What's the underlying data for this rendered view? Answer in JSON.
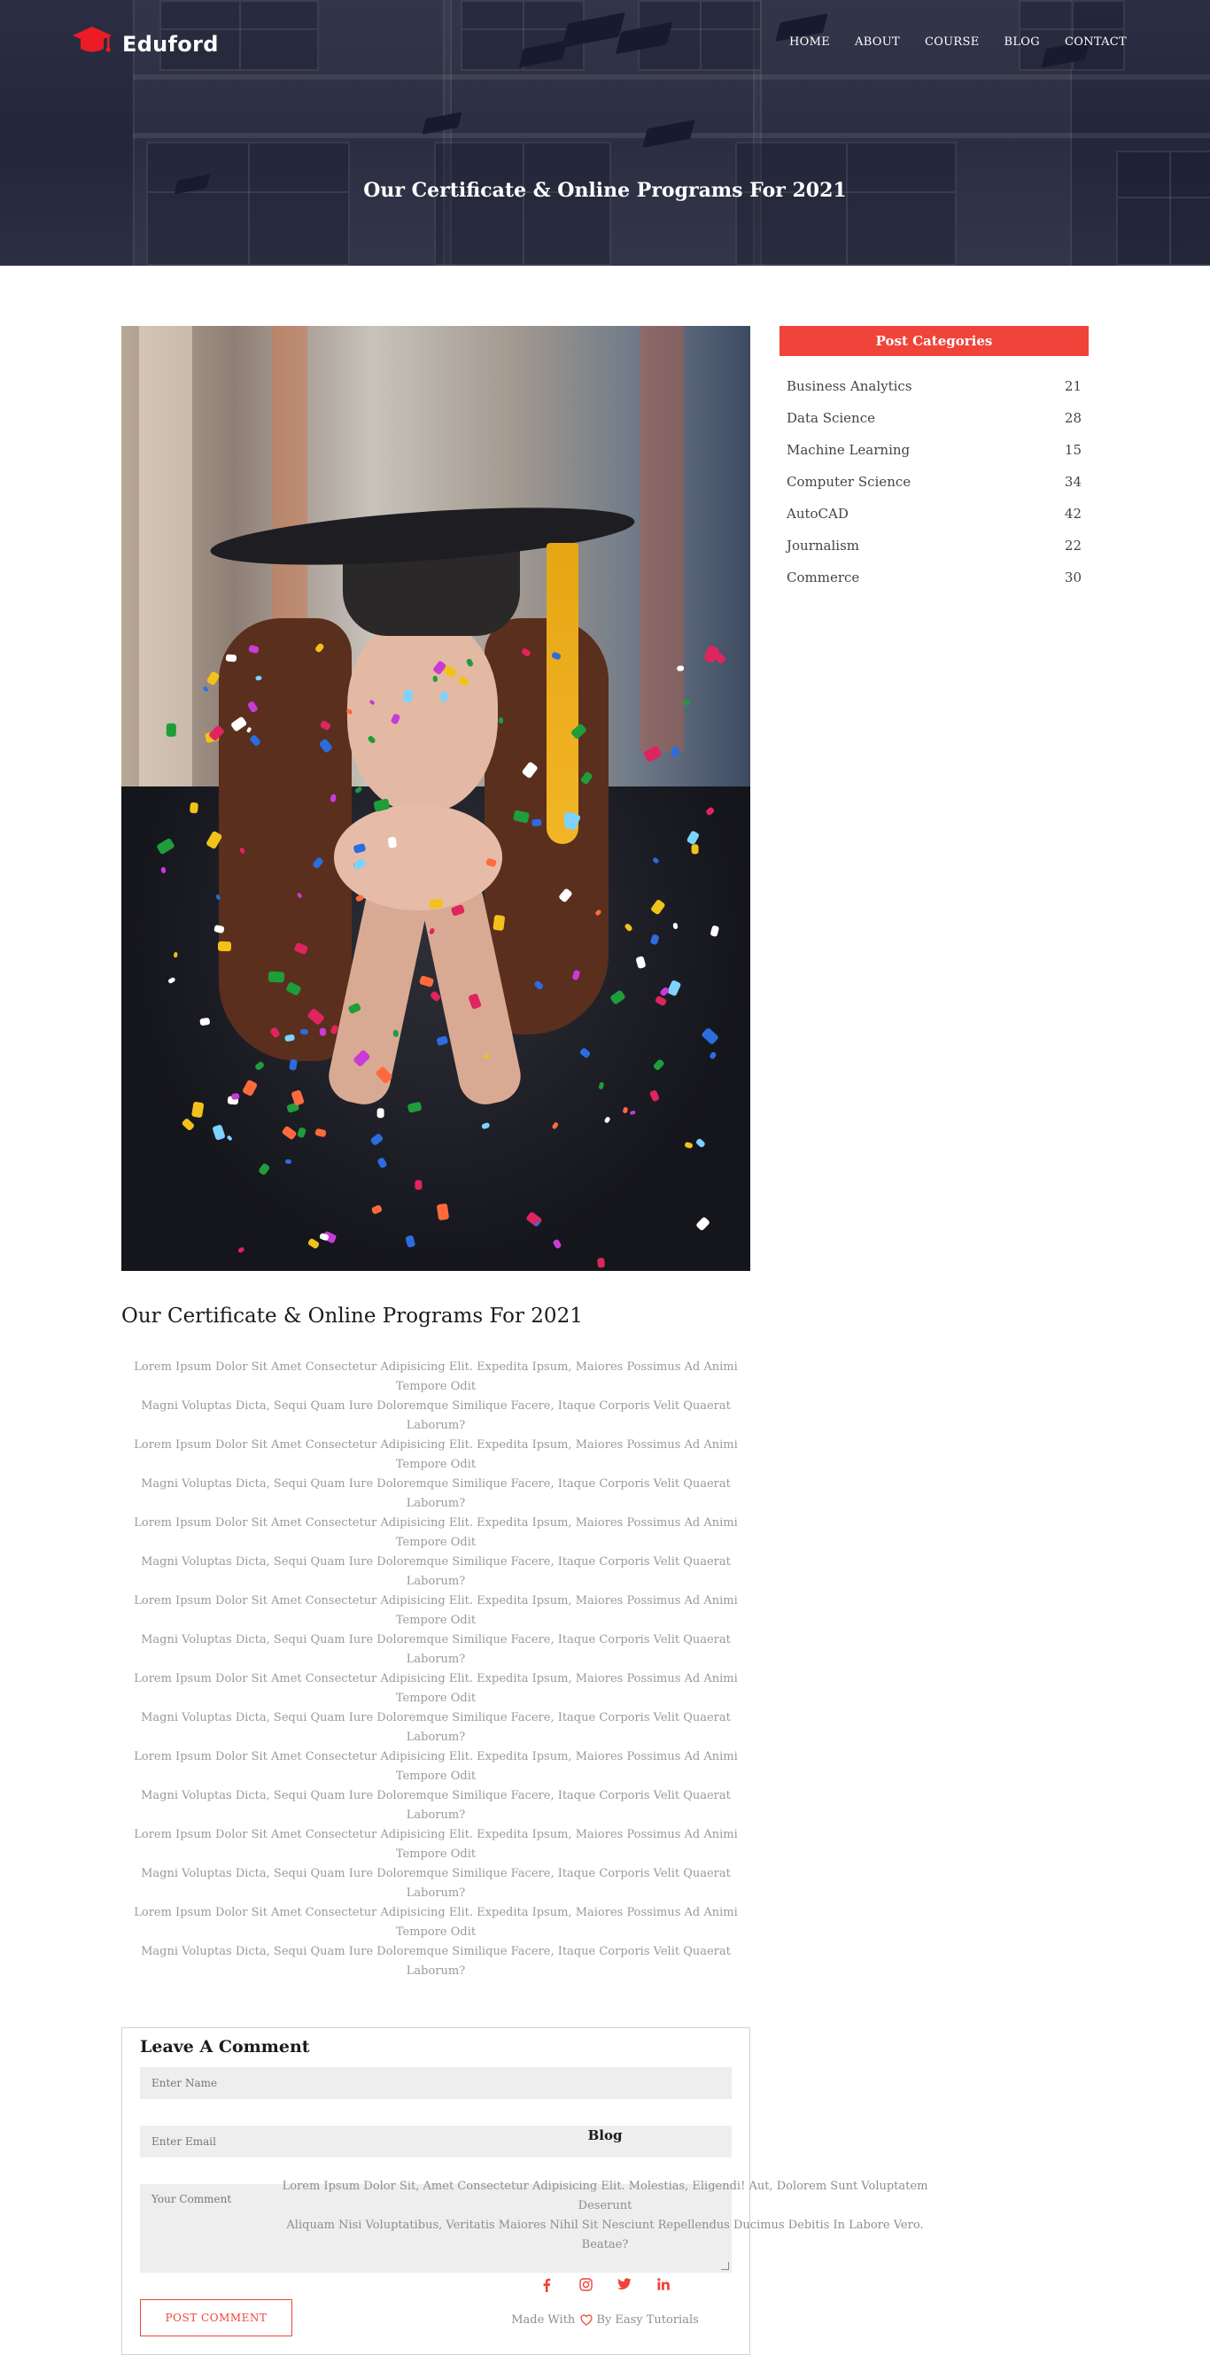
{
  "brand": {
    "name": "Eduford",
    "icon": "graduation-cap-icon",
    "accent_color": "#f04339"
  },
  "nav": {
    "items": [
      "HOME",
      "ABOUT",
      "COURSE",
      "BLOG",
      "CONTACT"
    ]
  },
  "hero": {
    "title": "Our Certificate & Online Programs For 2021"
  },
  "post": {
    "title": "Our Certificate & Online Programs For 2021",
    "paragraph_lines": [
      "Lorem Ipsum Dolor Sit Amet Consectetur Adipisicing Elit. Expedita Ipsum, Maiores Possimus Ad Animi Tempore Odit",
      "Magni Voluptas Dicta, Sequi Quam Iure Doloremque Similique Facere, Itaque Corporis Velit Quaerat Laborum?",
      "Lorem Ipsum Dolor Sit Amet Consectetur Adipisicing Elit. Expedita Ipsum, Maiores Possimus Ad Animi Tempore Odit",
      "Magni Voluptas Dicta, Sequi Quam Iure Doloremque Similique Facere, Itaque Corporis Velit Quaerat Laborum?",
      "Lorem Ipsum Dolor Sit Amet Consectetur Adipisicing Elit. Expedita Ipsum, Maiores Possimus Ad Animi Tempore Odit",
      "Magni Voluptas Dicta, Sequi Quam Iure Doloremque Similique Facere, Itaque Corporis Velit Quaerat Laborum?",
      "Lorem Ipsum Dolor Sit Amet Consectetur Adipisicing Elit. Expedita Ipsum, Maiores Possimus Ad Animi Tempore Odit",
      "Magni Voluptas Dicta, Sequi Quam Iure Doloremque Similique Facere, Itaque Corporis Velit Quaerat Laborum?",
      "Lorem Ipsum Dolor Sit Amet Consectetur Adipisicing Elit. Expedita Ipsum, Maiores Possimus Ad Animi Tempore Odit",
      "Magni Voluptas Dicta, Sequi Quam Iure Doloremque Similique Facere, Itaque Corporis Velit Quaerat Laborum?",
      "Lorem Ipsum Dolor Sit Amet Consectetur Adipisicing Elit. Expedita Ipsum, Maiores Possimus Ad Animi Tempore Odit",
      "Magni Voluptas Dicta, Sequi Quam Iure Doloremque Similique Facere, Itaque Corporis Velit Quaerat Laborum?",
      "Lorem Ipsum Dolor Sit Amet Consectetur Adipisicing Elit. Expedita Ipsum, Maiores Possimus Ad Animi Tempore Odit",
      "Magni Voluptas Dicta, Sequi Quam Iure Doloremque Similique Facere, Itaque Corporis Velit Quaerat Laborum?",
      "Lorem Ipsum Dolor Sit Amet Consectetur Adipisicing Elit. Expedita Ipsum, Maiores Possimus Ad Animi Tempore Odit",
      "Magni Voluptas Dicta, Sequi Quam Iure Doloremque Similique Facere, Itaque Corporis Velit Quaerat Laborum?"
    ]
  },
  "comment_form": {
    "title": "Leave A Comment",
    "name_placeholder": "Enter Name",
    "email_placeholder": "Enter Email",
    "comment_placeholder": "Your Comment",
    "submit_label": "POST COMMENT"
  },
  "sidebar": {
    "header": "Post Categories",
    "categories": [
      {
        "name": "Business Analytics",
        "count": "21"
      },
      {
        "name": "Data Science",
        "count": "28"
      },
      {
        "name": "Machine Learning",
        "count": "15"
      },
      {
        "name": "Computer Science",
        "count": "34"
      },
      {
        "name": "AutoCAD",
        "count": "42"
      },
      {
        "name": "Journalism",
        "count": "22"
      },
      {
        "name": "Commerce",
        "count": "30"
      }
    ]
  },
  "footer": {
    "title": "Blog",
    "text_lines": [
      "Lorem Ipsum Dolor Sit, Amet Consectetur Adipisicing Elit. Molestias, Eligendi! Aut, Dolorem Sunt Voluptatem Deserunt",
      "Aliquam Nisi Voluptatibus, Veritatis Maiores Nihil Sit Nesciunt Repellendus Ducimus Debitis In Labore Vero. Beatae?"
    ],
    "social_icons": [
      "facebook-icon",
      "instagram-icon",
      "twitter-icon",
      "linkedin-icon"
    ],
    "credit_prefix": "Made With",
    "credit_icon": "heart-icon",
    "credit_suffix": "By Easy Tutorials"
  }
}
